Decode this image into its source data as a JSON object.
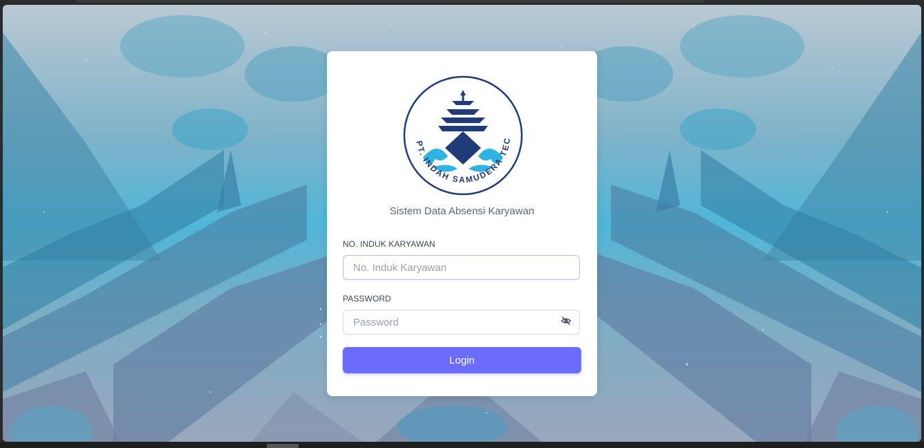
{
  "app": {
    "subtitle": "Sistem Data Absensi Karyawan"
  },
  "logo": {
    "ring_text": "PT. INDAH SAMUDERA TECH",
    "icon": "ship-wave-logo"
  },
  "form": {
    "employee_id": {
      "label": "NO. INDUK KARYAWAN",
      "placeholder": "No. Induk Karyawan",
      "value": ""
    },
    "password": {
      "label": "PASSWORD",
      "placeholder": "Password",
      "value": "",
      "toggle_icon": "eye-off-icon"
    },
    "submit_label": "Login"
  },
  "colors": {
    "accent": "#6c6cfa",
    "logo_navy": "#1f3c78",
    "logo_cyan": "#2fb3e3",
    "bg_cyan": "#4fb6d8"
  }
}
